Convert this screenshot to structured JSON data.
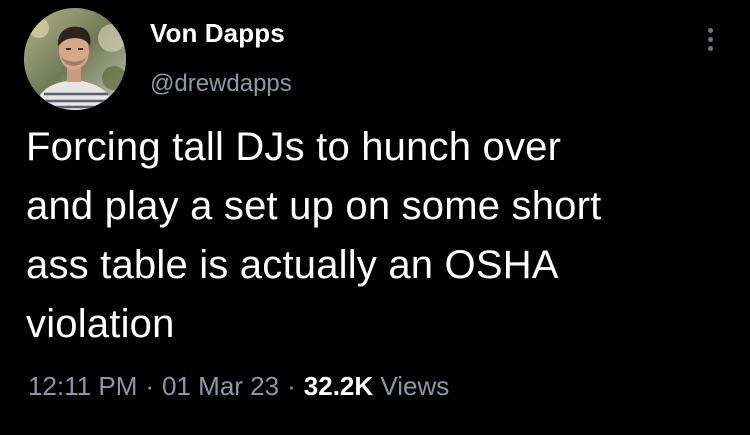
{
  "user": {
    "display_name": "Von Dapps",
    "handle": "@drewdapps"
  },
  "tweet": {
    "lines": [
      "Forcing tall DJs to hunch over",
      "and play a set up on some short",
      "ass table is actually an OSHA",
      "violation"
    ],
    "time": "12:11 PM",
    "date": "01 Mar 23",
    "separator": "·",
    "views_count": "32.2K",
    "views_label": "Views"
  },
  "icons": {
    "more": "more-vertical-icon",
    "avatar": "profile-photo"
  },
  "colors": {
    "background": "#000000",
    "primary_text": "#ffffff",
    "secondary_text": "#8b98a5"
  }
}
